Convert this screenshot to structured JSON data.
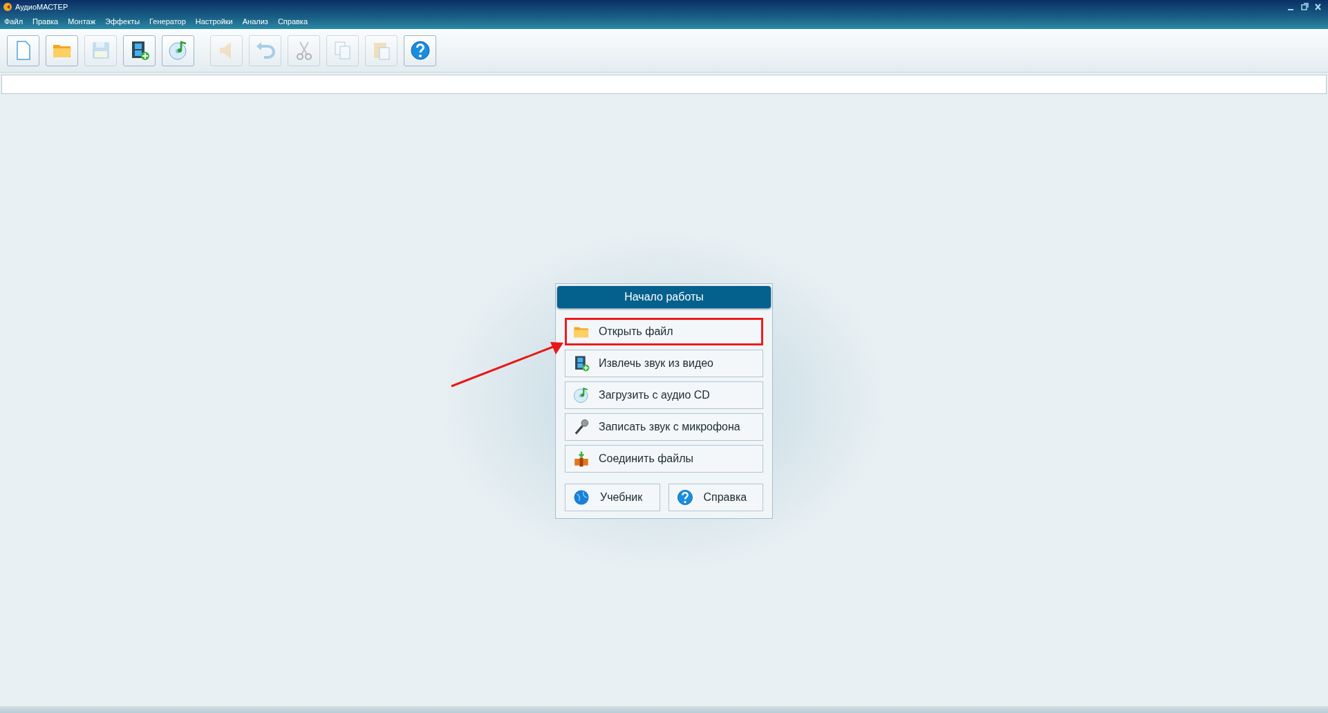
{
  "window": {
    "title": "АудиоМАСТЕР"
  },
  "menu": [
    "Файл",
    "Правка",
    "Монтаж",
    "Эффекты",
    "Генератор",
    "Настройки",
    "Анализ",
    "Справка"
  ],
  "toolbar": [
    {
      "kind": "new",
      "disabled": false
    },
    {
      "kind": "open",
      "disabled": false
    },
    {
      "kind": "save",
      "disabled": true
    },
    {
      "kind": "video",
      "disabled": false
    },
    {
      "kind": "cd",
      "disabled": false
    },
    {
      "kind": "volume",
      "disabled": true
    },
    {
      "kind": "undo",
      "disabled": true
    },
    {
      "kind": "cut",
      "disabled": true
    },
    {
      "kind": "copy",
      "disabled": true
    },
    {
      "kind": "paste",
      "disabled": true
    },
    {
      "kind": "help",
      "disabled": false
    }
  ],
  "start_panel": {
    "title": "Начало работы",
    "actions": [
      {
        "kind": "folder",
        "label": "Открыть файл",
        "highlighted": true
      },
      {
        "kind": "video",
        "label": "Извлечь звук из видео",
        "highlighted": false
      },
      {
        "kind": "cd",
        "label": "Загрузить с аудио CD",
        "highlighted": false
      },
      {
        "kind": "mic",
        "label": "Записать звук с микрофона",
        "highlighted": false
      },
      {
        "kind": "merge",
        "label": "Соединить файлы",
        "highlighted": false
      }
    ],
    "links": [
      {
        "kind": "globe",
        "label": "Учебник"
      },
      {
        "kind": "help",
        "label": "Справка"
      }
    ]
  }
}
